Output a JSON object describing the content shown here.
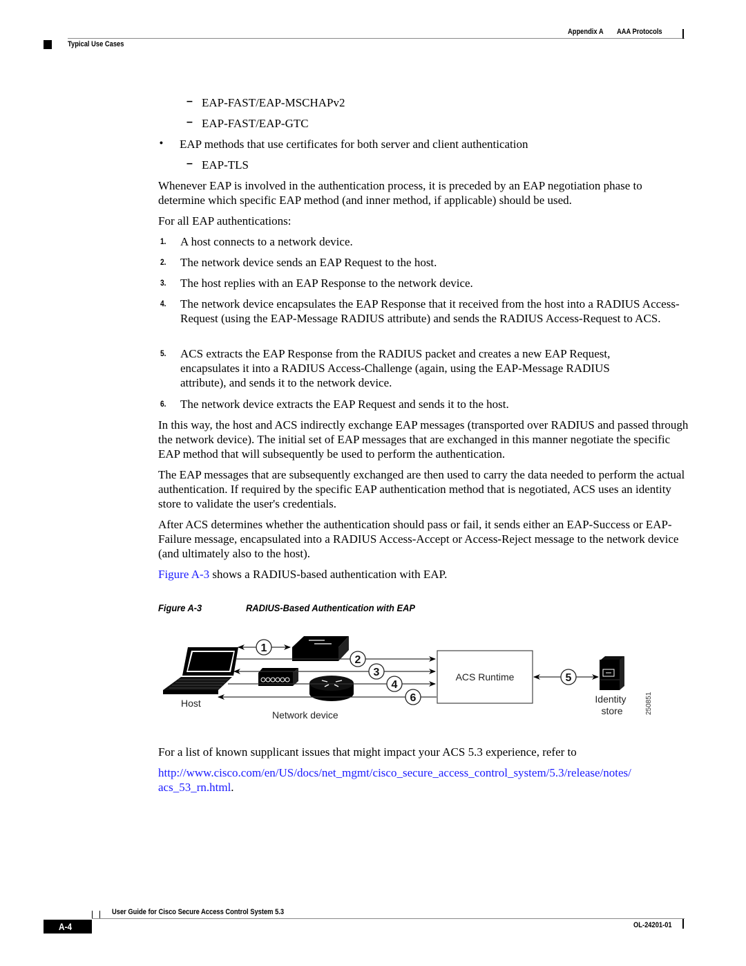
{
  "header": {
    "chapter": "Appendix A",
    "chapter_title": "AAA Protocols",
    "section": "Typical Use Cases"
  },
  "content": {
    "sub_items_top": [
      "EAP-FAST/EAP-MSCHAPv2",
      "EAP-FAST/EAP-GTC"
    ],
    "bullet": "EAP methods that use certificates for both server and client authentication",
    "sub_item_tls": "EAP-TLS",
    "para_negotiation": "Whenever EAP is involved in the authentication process, it is preceded by an EAP negotiation phase to determine which specific EAP method (and inner method, if applicable) should be used.",
    "para_for_all": "For all EAP authentications:",
    "steps": [
      {
        "num": "1.",
        "text": "A host connects to a network device."
      },
      {
        "num": "2.",
        "text": "The network device sends an EAP Request to the host."
      },
      {
        "num": "3.",
        "text": "The host replies with an EAP Response to the network device."
      },
      {
        "num": "4.",
        "text": "The network device encapsulates the EAP Response that it received from the host into a RADIUS Access-Request (using the EAP-Message RADIUS attribute) and sends the RADIUS Access-Request to ACS."
      },
      {
        "num": "5.",
        "text": "ACS extracts the EAP Response from the RADIUS packet and creates a new EAP Request, encapsulates it into a RADIUS Access-Challenge (again, using the EAP-Message RADIUS attribute), and sends it to the network device."
      },
      {
        "num": "6.",
        "text": "The network device extracts the EAP Request and sends it to the host."
      }
    ],
    "para_indirect": "In this way, the host and ACS indirectly exchange EAP messages (transported over RADIUS and passed through the network device). The initial set of EAP messages that are exchanged in this manner negotiate the specific EAP method that will subsequently be used to perform the authentication.",
    "para_subsequent": "The EAP messages that are subsequently exchanged are then used to carry the data needed to perform the actual authentication. If required by the specific EAP authentication method that is negotiated, ACS uses an identity store to validate the user's credentials.",
    "para_after": "After ACS determines whether the authentication should pass or fail, it sends either an EAP-Success or EAP-Failure message, encapsulated into a RADIUS Access-Accept or Access-Reject message to the network device (and ultimately also to the host).",
    "figure_ref_link": "Figure A-3",
    "figure_ref_rest": " shows a RADIUS-based authentication with EAP.",
    "para_supplicant": "For a list of known supplicant issues that might impact your ACS 5.3 experience, refer to",
    "url_line1": "http://www.cisco.com/en/US/docs/net_mgmt/cisco_secure_access_control_system/5.3/release/notes/",
    "url_line2": "acs_53_rn.html",
    "url_trailing": "."
  },
  "figure": {
    "number": "Figure A-3",
    "title": "RADIUS-Based Authentication with EAP",
    "labels": {
      "host": "Host",
      "network_device": "Network device",
      "acs_runtime": "ACS Runtime",
      "identity_line1": "Identity",
      "identity_line2": "store",
      "figure_id": "250851"
    },
    "steps": [
      "1",
      "2",
      "3",
      "4",
      "5",
      "6"
    ]
  },
  "footer": {
    "guide_title": "User Guide for Cisco Secure Access Control System 5.3",
    "page_number": "A-4",
    "doc_number": "OL-24201-01"
  }
}
